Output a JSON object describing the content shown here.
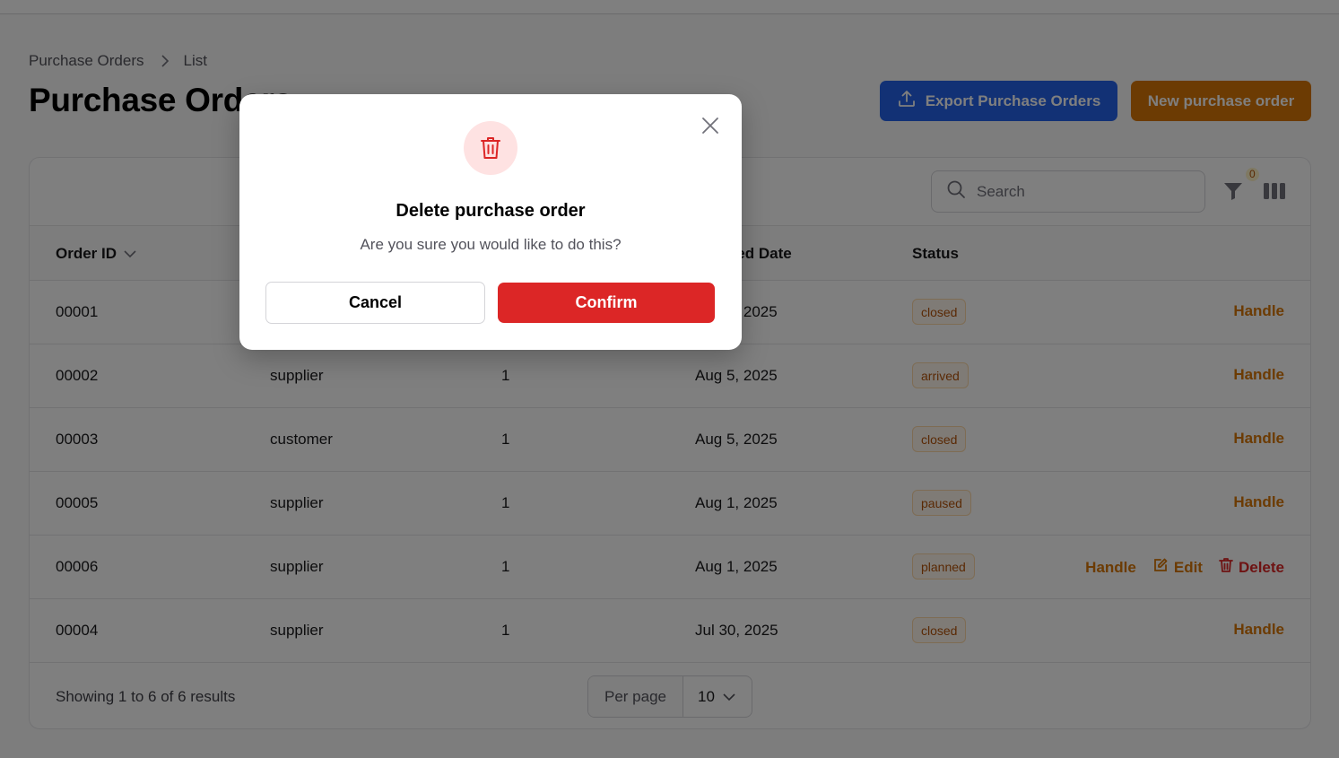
{
  "breadcrumb": {
    "parent": "Purchase Orders",
    "current": "List"
  },
  "page": {
    "title": "Purchase Orders"
  },
  "header_actions": {
    "export_label": "Export Purchase Orders",
    "new_label": "New purchase order"
  },
  "toolbar": {
    "search_placeholder": "Search",
    "filter_count": "0"
  },
  "table": {
    "headers": {
      "order_id": "Order ID",
      "type": "",
      "qty": "",
      "date": "Ordered Date",
      "status": "Status"
    },
    "rows": [
      {
        "id": "00001",
        "type": "",
        "qty": "",
        "date": "Aug 5, 2025",
        "status": "closed",
        "actions": [
          "Handle"
        ]
      },
      {
        "id": "00002",
        "type": "supplier",
        "qty": "1",
        "date": "Aug 5, 2025",
        "status": "arrived",
        "actions": [
          "Handle"
        ]
      },
      {
        "id": "00003",
        "type": "customer",
        "qty": "1",
        "date": "Aug 5, 2025",
        "status": "closed",
        "actions": [
          "Handle"
        ]
      },
      {
        "id": "00005",
        "type": "supplier",
        "qty": "1",
        "date": "Aug 1, 2025",
        "status": "paused",
        "actions": [
          "Handle"
        ]
      },
      {
        "id": "00006",
        "type": "supplier",
        "qty": "1",
        "date": "Aug 1, 2025",
        "status": "planned",
        "actions": [
          "Handle",
          "Edit",
          "Delete"
        ]
      },
      {
        "id": "00004",
        "type": "supplier",
        "qty": "1",
        "date": "Jul 30, 2025",
        "status": "closed",
        "actions": [
          "Handle"
        ]
      }
    ]
  },
  "footer": {
    "showing": "Showing 1 to 6 of 6 results",
    "per_page_label": "Per page",
    "per_page_value": "10"
  },
  "modal": {
    "title": "Delete purchase order",
    "text": "Are you sure you would like to do this?",
    "cancel_label": "Cancel",
    "confirm_label": "Confirm"
  },
  "colors": {
    "primary": "#2563eb",
    "accent": "#d97706",
    "danger": "#dc2626"
  }
}
